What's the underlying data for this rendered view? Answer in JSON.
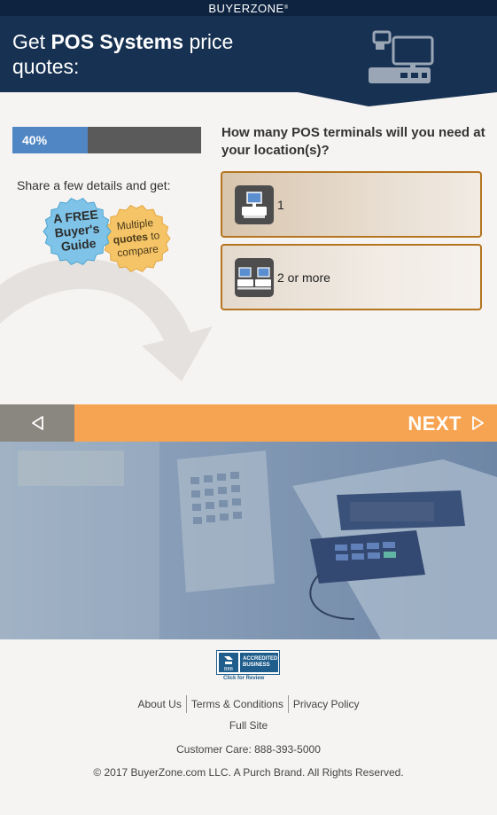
{
  "topbar": {
    "brand": "BUYERZONE"
  },
  "header": {
    "title_prefix": "Get ",
    "title_bold": "POS Systems",
    "title_suffix": " price quotes:",
    "icon": "pos-register-icon"
  },
  "progress": {
    "label": "40%",
    "value": 0.4
  },
  "sidebar": {
    "share_text": "Share a few details and get:",
    "badge_free_line1": "A FREE",
    "badge_free_line2": "Buyer's",
    "badge_free_line3": "Guide",
    "badge_quotes_line1": "Multiple",
    "badge_quotes_bold": "quotes",
    "badge_quotes_to": " to",
    "badge_quotes_line3": "compare"
  },
  "question": {
    "text": "How many POS terminals will you need at your location(s)?",
    "options": [
      {
        "label": "1",
        "icon": "single-terminal-icon"
      },
      {
        "label": "2 or more",
        "icon": "multiple-terminals-icon"
      }
    ]
  },
  "nav": {
    "back_icon": "chevron-left-icon",
    "next_label": "NEXT",
    "next_icon": "chevron-right-icon"
  },
  "footer": {
    "bbb_line1": "ACCREDITED",
    "bbb_line2": "BUSINESS",
    "bbb_caption": "Click for Review",
    "links": [
      "About Us",
      "Terms & Conditions",
      "Privacy Policy"
    ],
    "full_site": "Full Site",
    "customer_care": "Customer Care: 888-393-5000",
    "copyright": "© 2017 BuyerZone.com LLC. A Purch Brand. All Rights Reserved."
  },
  "colors": {
    "header_navy": "#163152",
    "progress_blue": "#5086c4",
    "next_orange": "#f7a452",
    "option_border": "#b5751f"
  }
}
